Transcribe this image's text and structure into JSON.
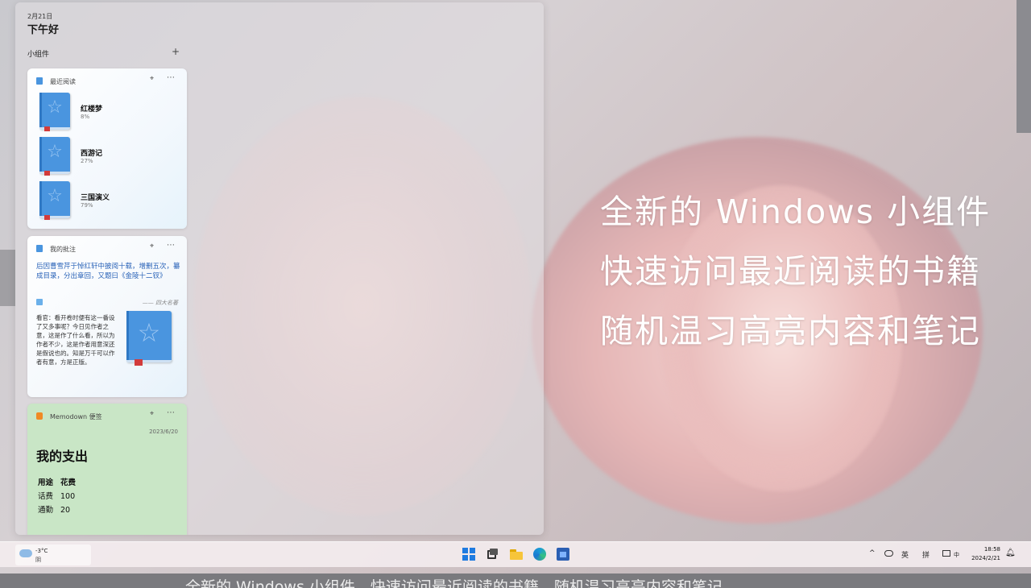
{
  "panel": {
    "date": "2月21日",
    "greeting": "下午好",
    "widgets_label": "小组件",
    "add_symbol": "+"
  },
  "recent_reading": {
    "title": "最近阅读",
    "books": [
      {
        "title": "红楼梦",
        "progress": "8%"
      },
      {
        "title": "西游记",
        "progress": "27%"
      },
      {
        "title": "三国演义",
        "progress": "79%"
      }
    ]
  },
  "notes": {
    "title": "我的批注",
    "quote": "后因曹雪芹于悼红轩中披阅十载，增删五次，纂成目录，分出章回，又题曰《金陵十二钗》",
    "source": "—— 四大名著",
    "body": "看官：看开卷时便有这一番设了又多事呢？今日见作者之意，这是作了什么看，所以为作者不少，这是作者用意深还是假说也的。知是万千可以作者有意，方是正版。"
  },
  "memo": {
    "title_app": "Memodown 便签",
    "date": "2023/6/20",
    "heading": "我的支出",
    "header_col1": "用途",
    "header_col2": "花费",
    "rows": [
      {
        "item": "话费",
        "cost": "100"
      },
      {
        "item": "通勤",
        "cost": "20"
      }
    ]
  },
  "overlay": {
    "line1": "全新的 Windows 小组件",
    "line2": "快速访问最近阅读的书籍",
    "line3": "随机温习高亮内容和笔记"
  },
  "caption_bottom": "全新的 Windows 小组件，快速访问最近阅读的书籍，随机温习高亮内容和笔记",
  "taskbar": {
    "weather_temp": "-3°C",
    "weather_cond": "阴",
    "tray_chevron": "^",
    "tray_lang": "英",
    "tray_ime": "拼",
    "tray_zh": "中",
    "time": "18:58",
    "date": "2024/2/21"
  },
  "colors": {
    "book_blue": "#4a95df",
    "memo_green": "#c9e6c6",
    "quote_blue": "#2a63b8",
    "win_blue": "#1f7be0"
  }
}
